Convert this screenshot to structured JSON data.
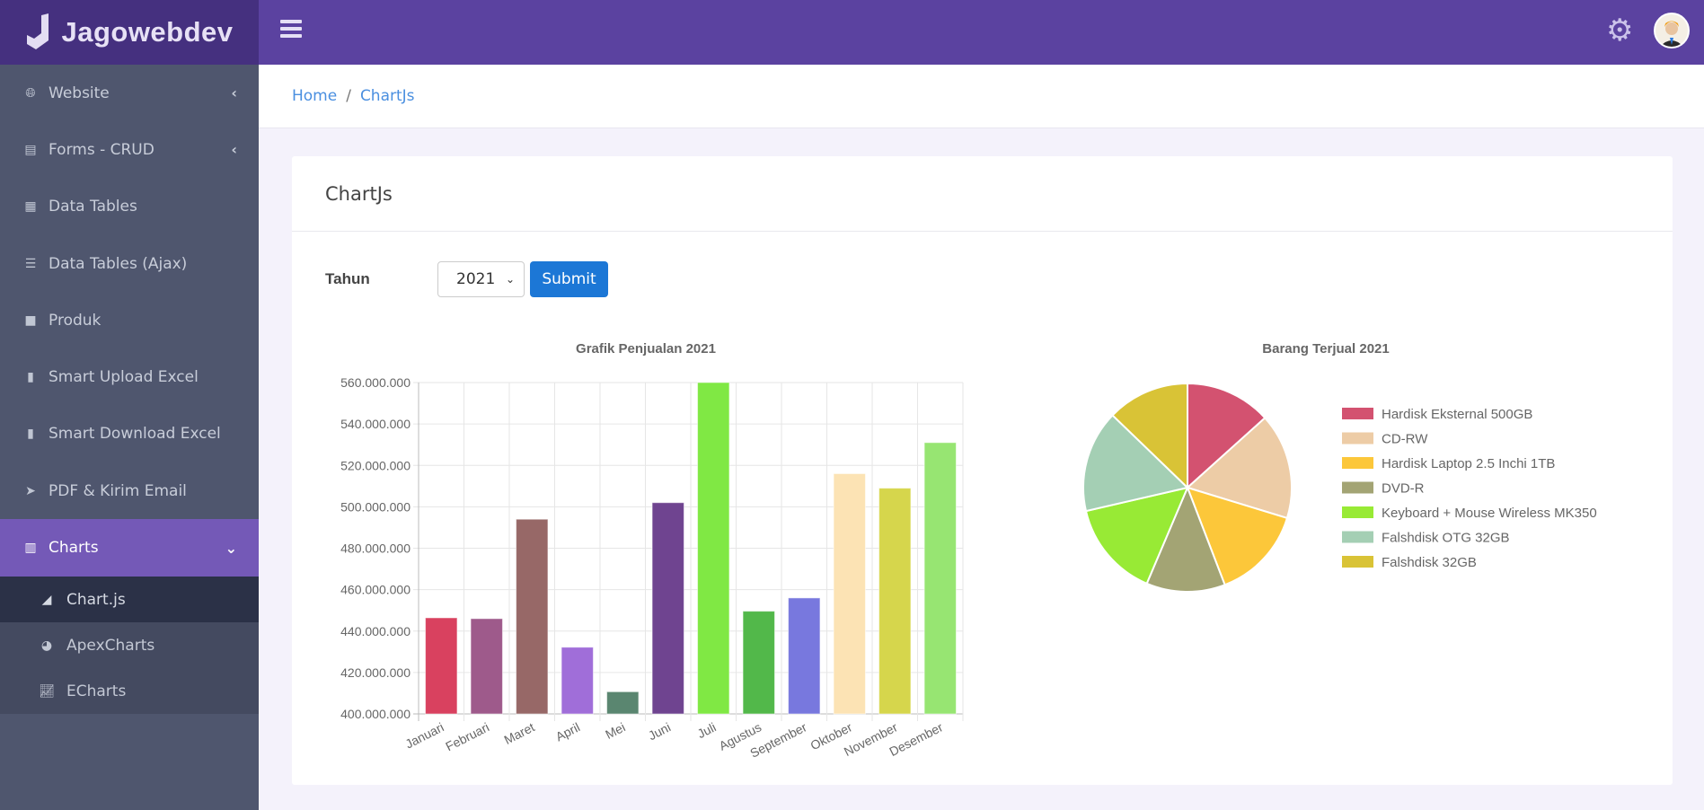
{
  "brand": {
    "name": "Jagowebdev"
  },
  "header": {
    "icons": [
      "menu-icon",
      "gear-icon",
      "avatar"
    ]
  },
  "sidebar": {
    "items": [
      {
        "label": "Website",
        "icon": "globe-icon",
        "chevron": "‹"
      },
      {
        "label": "Forms - CRUD",
        "icon": "form-icon",
        "chevron": "‹"
      },
      {
        "label": "Data Tables",
        "icon": "table-icon"
      },
      {
        "label": "Data Tables (Ajax)",
        "icon": "database-icon"
      },
      {
        "label": "Produk",
        "icon": "bag-icon"
      },
      {
        "label": "Smart Upload Excel",
        "icon": "file-upload-icon"
      },
      {
        "label": "Smart Download Excel",
        "icon": "file-download-icon"
      },
      {
        "label": "PDF & Kirim Email",
        "icon": "send-icon"
      },
      {
        "label": "Charts",
        "icon": "bar-chart-icon",
        "chevron": "⌄"
      }
    ],
    "subitems": [
      {
        "label": "Chart.js",
        "icon": "area-chart-icon"
      },
      {
        "label": "ApexCharts",
        "icon": "pie-chart-icon"
      },
      {
        "label": "ECharts",
        "icon": "line-chart-icon"
      }
    ]
  },
  "breadcrumb": {
    "home": "Home",
    "sep": "/",
    "current": "ChartJs"
  },
  "card": {
    "title": "ChartJs",
    "tahun_label": "Tahun",
    "year": "2021",
    "submit": "Submit"
  },
  "colors": {
    "header": "#5b42a0",
    "sidebar": "#4f566e",
    "active": "#7459b7",
    "button": "#1c77d6"
  },
  "chart_data": [
    {
      "type": "bar",
      "title": "Grafik Penjualan 2021",
      "xlabel": "",
      "ylabel": "",
      "categories": [
        "Januari",
        "Februari",
        "Maret",
        "April",
        "Mei",
        "Juni",
        "Juli",
        "Agustus",
        "September",
        "Oktober",
        "November",
        "Desember"
      ],
      "values": [
        446400000,
        446000000,
        494000000,
        432200000,
        410700000,
        502000000,
        560000000,
        449600000,
        456000000,
        516000000,
        509000000,
        531000000
      ],
      "colors": [
        "#d9415f",
        "#9e5a8b",
        "#976867",
        "#a06ed9",
        "#5a8670",
        "#6f4490",
        "#80e844",
        "#52b84a",
        "#7878de",
        "#fce3b4",
        "#d6d64c",
        "#97e572"
      ],
      "ylim": [
        400000000,
        560000000
      ],
      "yticks": [
        "400.000.000",
        "420.000.000",
        "440.000.000",
        "460.000.000",
        "480.000.000",
        "500.000.000",
        "520.000.000",
        "540.000.000",
        "560.000.000"
      ],
      "grid": true
    },
    {
      "type": "pie",
      "title": "Barang Terjual 2021",
      "legend": "right",
      "labels": [
        "Hardisk Eksternal 500GB",
        "CD-RW",
        "Hardisk Laptop 2.5 Inchi 1TB",
        "DVD-R",
        "Keyboard + Mouse Wireless MK350",
        "Falshdisk OTG 32GB",
        "Falshdisk 32GB"
      ],
      "values": [
        48,
        59,
        52,
        44,
        54,
        57,
        46
      ],
      "colors": [
        "#d35270",
        "#edcca6",
        "#fcc73a",
        "#a3a474",
        "#98ea35",
        "#a4cfb4",
        "#d9c336"
      ]
    }
  ]
}
